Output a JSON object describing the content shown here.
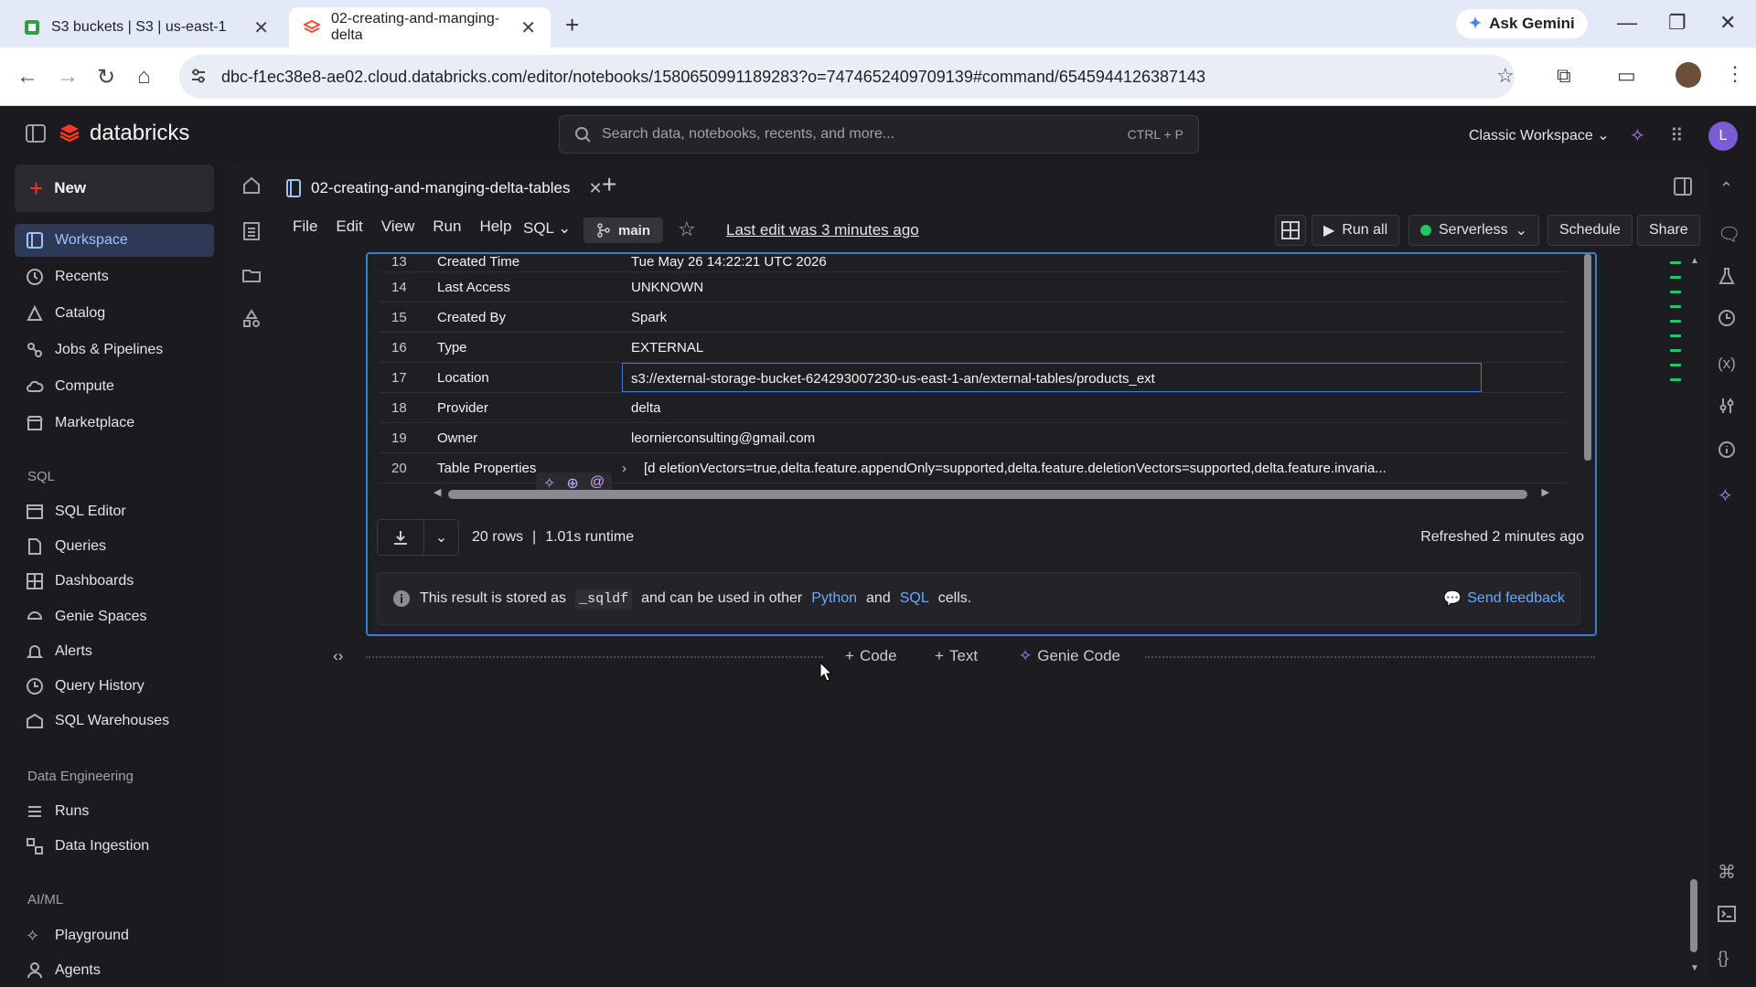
{
  "browser": {
    "tabs": [
      {
        "title": "S3 buckets | S3 | us-east-1",
        "icon": "s3-icon"
      },
      {
        "title": "02-creating-and-manging-delta",
        "icon": "databricks-icon"
      }
    ],
    "ask_gemini": "Ask Gemini",
    "url": "dbc-f1ec38e8-ae02.cloud.databricks.com/editor/notebooks/1580650991189283?o=7474652409709139#command/6545944126387143"
  },
  "header": {
    "brand": "databricks",
    "search_placeholder": "Search data, notebooks, recents, and more...",
    "search_shortcut": "CTRL + P",
    "workspace": "Classic Workspace",
    "avatar": "L"
  },
  "sidebar": {
    "new_label": "New",
    "items": [
      {
        "label": "Workspace",
        "icon": "workspace-icon",
        "selected": true
      },
      {
        "label": "Recents",
        "icon": "clock-icon"
      },
      {
        "label": "Catalog",
        "icon": "catalog-icon"
      },
      {
        "label": "Jobs & Pipelines",
        "icon": "jobs-icon"
      },
      {
        "label": "Compute",
        "icon": "cloud-icon"
      },
      {
        "label": "Marketplace",
        "icon": "store-icon"
      }
    ],
    "sql_heading": "SQL",
    "sql_items": [
      {
        "label": "SQL Editor",
        "icon": "sql-editor-icon"
      },
      {
        "label": "Queries",
        "icon": "query-icon"
      },
      {
        "label": "Dashboards",
        "icon": "dashboard-icon"
      },
      {
        "label": "Genie Spaces",
        "icon": "genie-icon"
      },
      {
        "label": "Alerts",
        "icon": "bell-icon"
      },
      {
        "label": "Query History",
        "icon": "history-icon"
      },
      {
        "label": "SQL Warehouses",
        "icon": "warehouse-icon"
      }
    ],
    "de_heading": "Data Engineering",
    "de_items": [
      {
        "label": "Runs",
        "icon": "runs-icon"
      },
      {
        "label": "Data Ingestion",
        "icon": "ingestion-icon"
      }
    ],
    "ml_heading": "AI/ML",
    "ml_items": [
      {
        "label": "Playground",
        "icon": "playground-icon"
      },
      {
        "label": "Agents",
        "icon": "agents-icon"
      }
    ]
  },
  "notebook": {
    "tab_title": "02-creating-and-manging-delta-tables",
    "menu": [
      "File",
      "Edit",
      "View",
      "Run",
      "Help"
    ],
    "language": "SQL",
    "branch": "main",
    "last_edit": "Last edit was 3 minutes ago",
    "run_all": "Run all",
    "compute": "Serverless",
    "schedule": "Schedule",
    "share": "Share"
  },
  "result": {
    "rows": [
      {
        "n": "13",
        "key": "Created Time",
        "value": "Tue May 26 14:22:21 UTC 2026"
      },
      {
        "n": "14",
        "key": "Last Access",
        "value": "UNKNOWN"
      },
      {
        "n": "15",
        "key": "Created By",
        "value": "Spark"
      },
      {
        "n": "16",
        "key": "Type",
        "value": "EXTERNAL"
      },
      {
        "n": "17",
        "key": "Location",
        "value": "s3://external-storage-bucket-624293007230-us-east-1-an/external-tables/products_ext"
      },
      {
        "n": "18",
        "key": "Provider",
        "value": "delta"
      },
      {
        "n": "19",
        "key": "Owner",
        "value": "leornierconsulting@gmail.com"
      },
      {
        "n": "20",
        "key": "Table Properties",
        "value": "[d                eletionVectors=true,delta.feature.appendOnly=supported,delta.feature.deletionVectors=supported,delta.feature.invaria..."
      }
    ],
    "row_count": "20 rows",
    "runtime": "1.01s runtime",
    "refreshed": "Refreshed 2 minutes ago",
    "note_pre": "This result is stored as",
    "note_var": "_sqldf",
    "note_mid": "and can be used in other",
    "note_python": "Python",
    "note_and": "and",
    "note_sql": "SQL",
    "note_end": "cells.",
    "feedback": "Send feedback"
  },
  "adders": {
    "code": "Code",
    "text": "Text",
    "genie": "Genie Code"
  }
}
